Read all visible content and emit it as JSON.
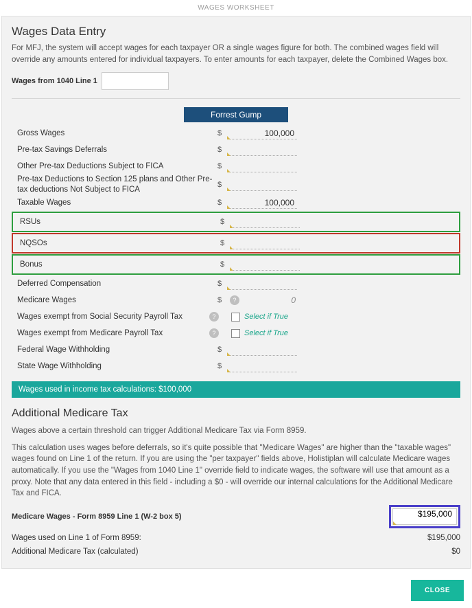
{
  "header": {
    "title": "WAGES WORKSHEET"
  },
  "wagesDataEntry": {
    "title": "Wages Data Entry",
    "desc": "For MFJ, the system will accept wages for each taxpayer OR a single wages figure for both. The combined wages field will override any amounts entered for individual taxpayers. To enter amounts for each taxpayer, delete the Combined Wages box.",
    "combinedLabel": "Wages from 1040 Line 1",
    "combinedValue": "",
    "taxpayerName": "Forrest Gump",
    "rows": {
      "grossWages": {
        "label": "Gross Wages",
        "value": "100,000"
      },
      "pretaxSavings": {
        "label": "Pre-tax Savings Deferrals",
        "value": ""
      },
      "otherPretaxFica": {
        "label": "Other Pre-tax Deductions Subject to FICA",
        "value": ""
      },
      "pretax125": {
        "label": "Pre-tax Deductions to Section 125 plans and Other Pre-tax deductions Not Subject to FICA",
        "value": ""
      },
      "taxableWages": {
        "label": "Taxable Wages",
        "value": "100,000"
      },
      "rsus": {
        "label": "RSUs",
        "value": ""
      },
      "nqsos": {
        "label": "NQSOs",
        "value": ""
      },
      "bonus": {
        "label": "Bonus",
        "value": ""
      },
      "deferredComp": {
        "label": "Deferred Compensation",
        "value": ""
      },
      "medicareWages": {
        "label": "Medicare Wages",
        "value": "0"
      },
      "exemptSS": {
        "label": "Wages exempt from Social Security Payroll Tax",
        "placeholder": "Select if True"
      },
      "exemptMedicare": {
        "label": "Wages exempt from Medicare Payroll Tax",
        "placeholder": "Select if True"
      },
      "federalWithholding": {
        "label": "Federal Wage Withholding",
        "value": ""
      },
      "stateWithholding": {
        "label": "State Wage Withholding",
        "value": ""
      }
    },
    "calcBanner": "Wages used in income tax calculations: $100,000"
  },
  "amt": {
    "title": "Additional Medicare Tax",
    "desc1": "Wages above a certain threshold can trigger Additional Medicare Tax via Form 8959.",
    "desc2": "This calculation uses wages before deferrals, so it's quite possible that \"Medicare Wages\" are higher than the \"taxable wages\" wages found on Line 1 of the return. If you are using the \"per taxpayer\" fields above, Holistiplan will calculate Medicare wages automatically. If you use the \"Wages from 1040 Line 1\" override field to indicate wages, the software will use that amount as a proxy. Note that any data entered in this field - including a $0 - will override our internal calculations for the Additional Medicare Tax and FICA.",
    "mwLabel": "Medicare Wages - Form 8959 Line 1 (W-2 box 5)",
    "mwValue": "$195,000",
    "usedLabel": "Wages used on Line 1 of Form 8959:",
    "usedValue": "$195,000",
    "calcLabel": "Additional Medicare Tax (calculated)",
    "calcValue": "$0"
  },
  "footer": {
    "close": "CLOSE"
  }
}
